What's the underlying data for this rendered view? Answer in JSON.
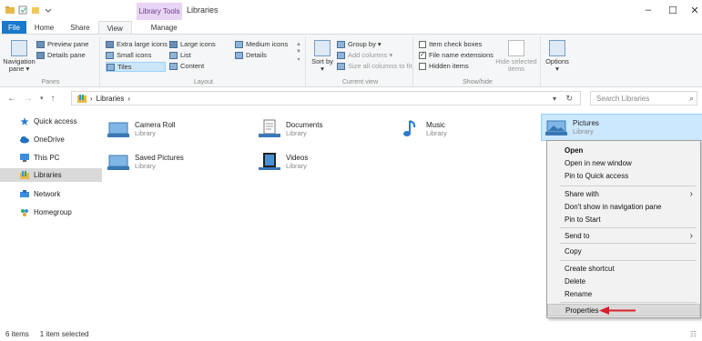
{
  "titlebar": {
    "context_tab": "Library Tools",
    "title": "Libraries",
    "minimize": "–",
    "maximize": "☐",
    "close": "✕"
  },
  "tabs": {
    "file": "File",
    "home": "Home",
    "share": "Share",
    "view": "View",
    "manage": "Manage"
  },
  "ribbon": {
    "panes": {
      "navigation_pane": "Navigation pane ▾",
      "preview_pane": "Preview pane",
      "details_pane": "Details pane",
      "label": "Panes"
    },
    "layout": {
      "extra_large_icons": "Extra large icons",
      "large_icons": "Large icons",
      "medium_icons": "Medium icons",
      "small_icons": "Small icons",
      "list": "List",
      "details": "Details",
      "tiles": "Tiles",
      "content": "Content",
      "label": "Layout"
    },
    "current_view": {
      "sort_by": "Sort by ▾",
      "group_by": "Group by ▾",
      "add_columns": "Add columns ▾",
      "size_columns": "Size all columns to fit",
      "label": "Current view"
    },
    "show_hide": {
      "item_check_boxes": "Item check boxes",
      "file_name_extensions": "File name extensions",
      "hidden_items": "Hidden items",
      "hide_selected": "Hide selected items",
      "label": "Show/hide"
    },
    "options": "Options ▾"
  },
  "address": {
    "back": "←",
    "forward": "→",
    "recent": "▾",
    "up": "↑",
    "path_sep": "›",
    "path": "Libraries",
    "path_end": "›",
    "dropdown": "▾",
    "refresh": "↻",
    "search_placeholder": "Search Libraries",
    "search_icon": "⌕"
  },
  "sidebar": {
    "items": [
      {
        "label": "Quick access"
      },
      {
        "label": "OneDrive"
      },
      {
        "label": "This PC"
      },
      {
        "label": "Libraries"
      },
      {
        "label": "Network"
      },
      {
        "label": "Homegroup"
      }
    ]
  },
  "libraries": [
    {
      "name": "Camera Roll",
      "type": "Library"
    },
    {
      "name": "Documents",
      "type": "Library"
    },
    {
      "name": "Music",
      "type": "Library"
    },
    {
      "name": "Pictures",
      "type": "Library"
    },
    {
      "name": "Saved Pictures",
      "type": "Library"
    },
    {
      "name": "Videos",
      "type": "Library"
    }
  ],
  "context_menu": {
    "open": "Open",
    "open_new_window": "Open in new window",
    "pin_quick_access": "Pin to Quick access",
    "share_with": "Share with",
    "dont_show": "Don't show in navigation pane",
    "pin_start": "Pin to Start",
    "send_to": "Send to",
    "copy": "Copy",
    "create_shortcut": "Create shortcut",
    "delete": "Delete",
    "rename": "Rename",
    "properties": "Properties",
    "submenu_arrow": "›"
  },
  "status": {
    "items": "6 items",
    "selected": "1 item selected"
  },
  "colors": {
    "accent": "#1979ca",
    "selection": "#cce8ff",
    "arrow": "#d6202a"
  }
}
